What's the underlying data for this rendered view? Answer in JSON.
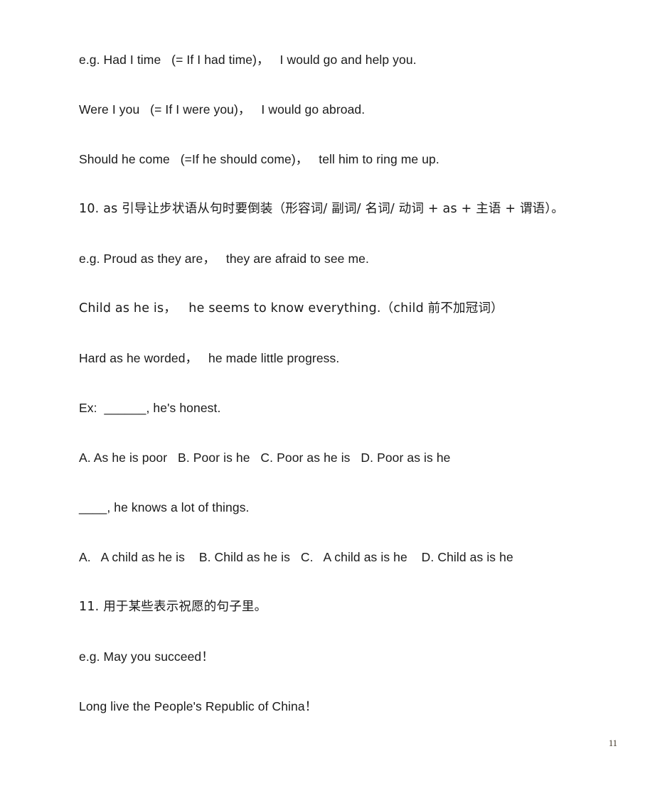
{
  "document": {
    "page_number": "11",
    "background_color": "#ffffff",
    "text_color": "#1a1a1a",
    "lines": [
      {
        "id": "example-had-i-time",
        "text": "e.g. Had I time   (= If I had time)，   I would go and help you.",
        "script": "latin"
      },
      {
        "id": "example-were-i-you",
        "text": "Were I you   (= If I were you)，   I would go abroad.",
        "script": "latin"
      },
      {
        "id": "example-should-he-come",
        "text": "Should he come   (=If he should come)，   tell him to ring me up.",
        "script": "latin"
      },
      {
        "id": "rule-10-as-inversion",
        "text": "10. as 引导让步状语从句时要倒装（形容词/ 副词/ 名词/ 动词 + as + 主语 + 谓语）。",
        "script": "cjk"
      },
      {
        "id": "example-proud-as-they-are",
        "text": "e.g. Proud as they are，   they are afraid to see me.",
        "script": "latin"
      },
      {
        "id": "example-child-as-he-is",
        "text": "Child as he is，   he seems to know everything.（child 前不加冠词）",
        "script": "cjk"
      },
      {
        "id": "example-hard-as-he-worded",
        "text": "Hard as he worded，   he made little progress.",
        "script": "latin"
      },
      {
        "id": "exercise-1-stem",
        "text": "Ex:  ______, he's honest.",
        "script": "latin"
      },
      {
        "id": "exercise-1-options",
        "text": "A. As he is poor   B. Poor is he   C. Poor as he is   D. Poor as is he",
        "script": "latin"
      },
      {
        "id": "exercise-2-stem",
        "text": "____, he knows a lot of things.",
        "script": "latin"
      },
      {
        "id": "exercise-2-options",
        "text": "A.   A child as he is    B. Child as he is   C.   A child as is he    D. Child as is he",
        "script": "latin"
      },
      {
        "id": "rule-11-wishes",
        "text": "11. 用于某些表示祝愿的句子里。",
        "script": "cjk"
      },
      {
        "id": "example-may-you-succeed",
        "text": "e.g. May you succeed！",
        "script": "latin"
      },
      {
        "id": "example-long-live",
        "text": "Long live the People's Republic of China！",
        "script": "latin"
      }
    ]
  }
}
